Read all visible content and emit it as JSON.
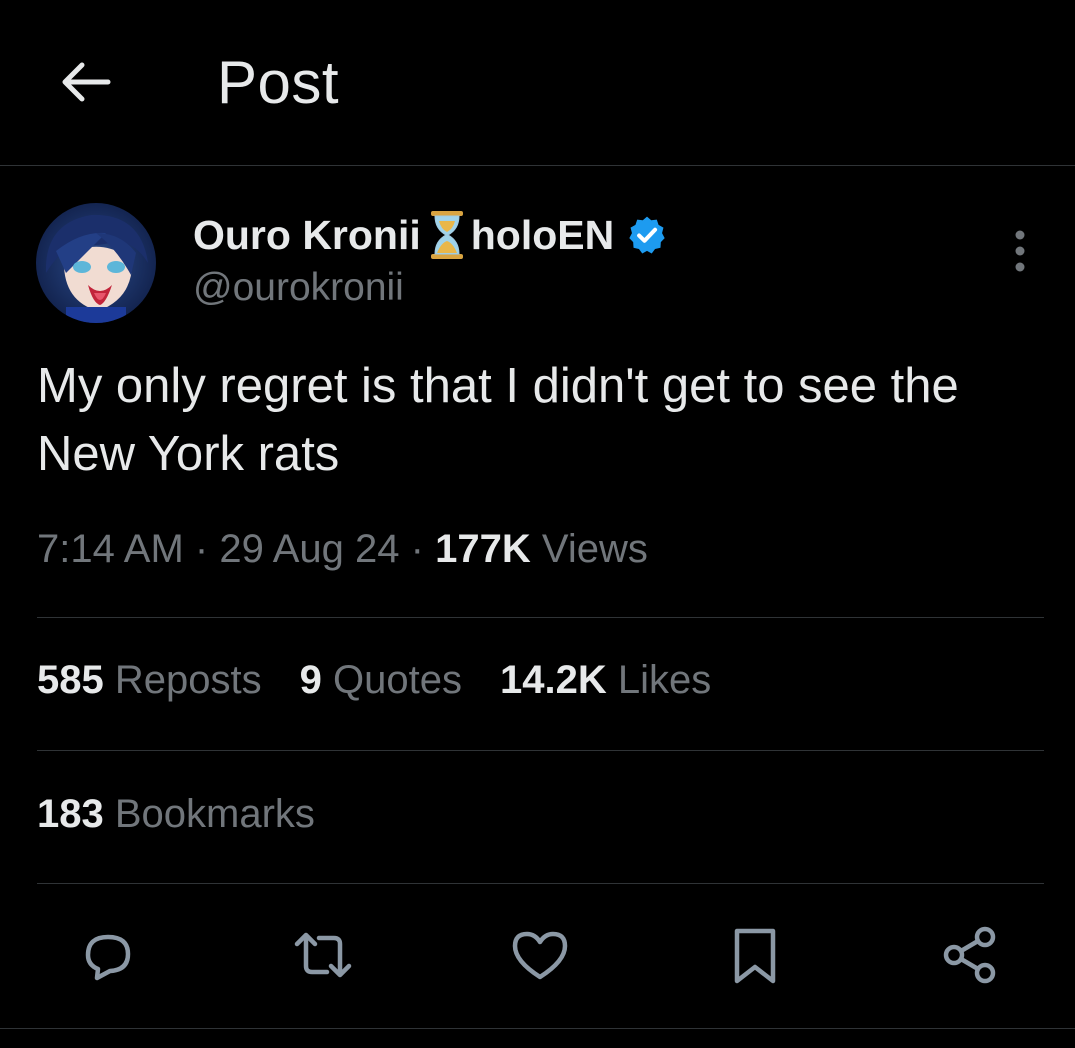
{
  "header": {
    "title": "Post"
  },
  "author": {
    "display_name": "Ouro Kronii",
    "affiliation": "holoEN",
    "handle": "@ourokronii"
  },
  "tweet": {
    "text": "My only regret is that I didn't get to see the New York rats",
    "time": "7:14 AM",
    "date": "29 Aug 24",
    "views_count": "177K",
    "views_label": "Views",
    "separator": "·"
  },
  "stats": {
    "reposts": {
      "count": "585",
      "label": "Reposts"
    },
    "quotes": {
      "count": "9",
      "label": "Quotes"
    },
    "likes": {
      "count": "14.2K",
      "label": "Likes"
    },
    "bookmarks": {
      "count": "183",
      "label": "Bookmarks"
    }
  },
  "actions": [
    "reply-icon",
    "repost-icon",
    "like-icon",
    "bookmark-icon",
    "share-icon"
  ],
  "colors": {
    "background": "#000000",
    "text": "#e7e9ea",
    "muted": "#71767b",
    "divider": "#2f3336",
    "verified": "#1d9bf0"
  }
}
